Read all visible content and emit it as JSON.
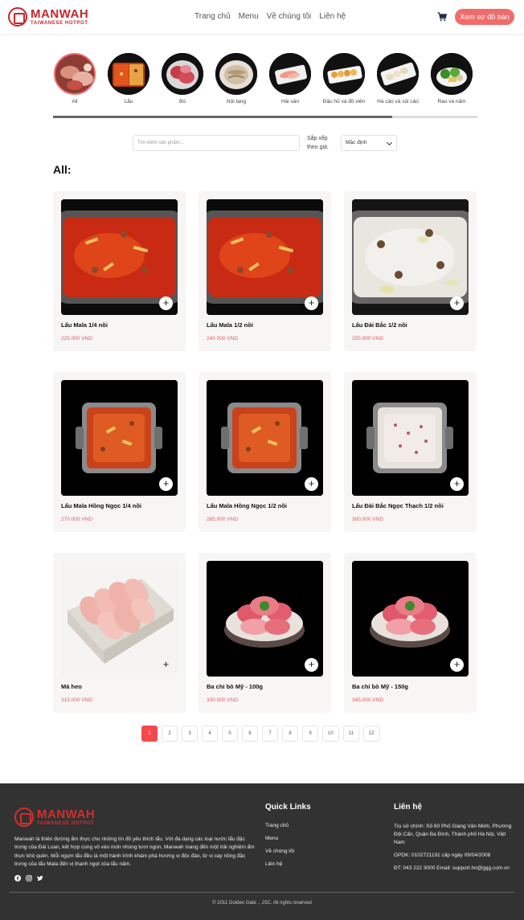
{
  "brand": {
    "name": "MANWAH",
    "tagline": "TAIWANESE HOTPOT"
  },
  "nav": [
    "Trang chủ",
    "Menu",
    "Về chúng tôi",
    "Liên hệ"
  ],
  "header": {
    "cta": "Xem sơ đồ bàn"
  },
  "categories": [
    "All",
    "Lẩu",
    "Bò",
    "Nội tạng",
    "Hải sản",
    "Đậu hũ và đồ viên",
    "Há cảo và sủi cảo",
    "Rau và nấm"
  ],
  "categories_scroll_fraction": 0.8,
  "filters": {
    "search_placeholder": "Tìm kiếm sản phẩm...",
    "sort_label": "Sắp xếp theo giá:",
    "sort_value": "Mặc định"
  },
  "section_title": "All:",
  "products": [
    {
      "name": "Lẩu Mala 1/4 nồi",
      "price": "225.000 VND"
    },
    {
      "name": "Lẩu Mala 1/2 nồi",
      "price": "240.000 VND"
    },
    {
      "name": "Lẩu Đài Bắc 1/2 nồi",
      "price": "255.000 VND"
    },
    {
      "name": "Lẩu Mala Hồng Ngọc 1/4 nồi",
      "price": "270.000 VND"
    },
    {
      "name": "Lẩu Mala Hồng Ngọc 1/2 nồi",
      "price": "285.000 VND"
    },
    {
      "name": "Lẩu Đài Bắc Ngọc Thạch 1/2 nồi",
      "price": "300.000 VND"
    },
    {
      "name": "Má heo",
      "price": "315.000 VND"
    },
    {
      "name": "Ba chỉ bò Mỹ - 100g",
      "price": "330.000 VND"
    },
    {
      "name": "Ba chỉ bò Mỹ - 150g",
      "price": "345.000 VND"
    }
  ],
  "add_button": "+",
  "pagination": {
    "pages": [
      "1",
      "2",
      "3",
      "4",
      "5",
      "6",
      "7",
      "8",
      "9",
      "10",
      "11",
      "12"
    ],
    "current": "1"
  },
  "footer": {
    "about": "Manwah là thiên đường ẩm thực cho những tín đồ yêu thích lẩu. Với đa dạng các loại nước lẩu đặc trưng của Đài Loan, kết hợp cùng vô vàn món nhúng tươi ngon, Manwah mang đến một trải nghiệm ẩm thực khó quên. Mỗi ngụm lẩu đều là một hành trình khám phá hương vị độc đáo, từ vị cay nồng đặc trưng của lẩu Mala đến vị thanh ngọt của lẩu nấm.",
    "quick_links_title": "Quick Links",
    "quick_links": [
      "Trang chủ",
      "Menu",
      "Về chúng tôi",
      "Liên hệ"
    ],
    "contact_title": "Liên hệ",
    "address": "Trụ sở chính: Số 60 Phố Giang Văn Minh, Phường Đội Cấn, Quận Ba Đình, Thành phố Hà Nội, Việt Nam",
    "license": "GPDK: 0102721191 cấp ngày 09/04/2008",
    "phone_email": "ĐT: 043 222 3000 Email: support.hn@ggg.com.vn",
    "copyright": "© 2011 Golden Gate ., JSC. All rights reserved"
  },
  "colors": {
    "brand_red": "#c8262c",
    "accent": "#f26b6b",
    "active_page": "#f4494b",
    "footer_bg": "#323232",
    "price": "#e05b5b"
  },
  "icons": {
    "cart": "cart-icon",
    "plus": "plus-icon",
    "facebook": "facebook-icon",
    "instagram": "instagram-icon",
    "twitter": "twitter-icon"
  }
}
